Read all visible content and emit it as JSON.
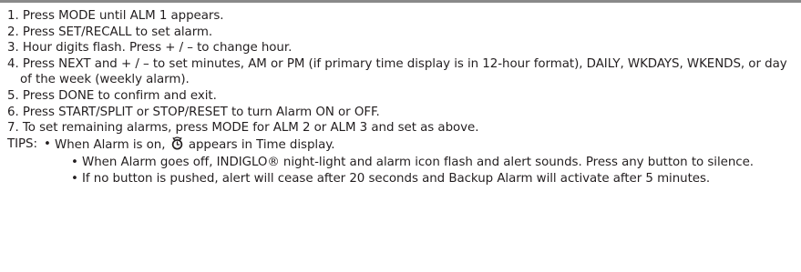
{
  "steps": [
    {
      "number": "1.",
      "text": "Press MODE until ALM 1 appears."
    },
    {
      "number": "2.",
      "text": "Press SET/RECALL to set alarm."
    },
    {
      "number": "3.",
      "text": "Hour digits flash. Press + / – to change hour."
    },
    {
      "number": "4.",
      "text": "Press NEXT and + / – to set minutes, AM or PM (if primary time display is in 12-hour format), DAILY, WKDAYS, WKENDS, or day of the week (weekly alarm)."
    },
    {
      "number": "5.",
      "text": "Press DONE to confirm and exit."
    },
    {
      "number": "6.",
      "text": "Press START/SPLIT or STOP/RESET to turn Alarm ON or OFF."
    },
    {
      "number": "7.",
      "text": "To set remaining alarms, press MODE for ALM 2 or ALM 3 and set as above."
    }
  ],
  "tips": {
    "label": "TIPS:",
    "bullet": "•",
    "items": [
      {
        "before_icon": "When Alarm is on, ",
        "icon": "alarm-clock-icon",
        "after_icon": " appears in Time display."
      },
      {
        "text": "When Alarm goes off, INDIGLO® night-light and alarm icon flash and alert sounds. Press any button to silence."
      },
      {
        "text": "If no button is pushed, alert will cease after 20 seconds and Backup Alarm will activate after 5 minutes."
      }
    ]
  },
  "colors": {
    "text": "#231f20",
    "top_bar": "#8a8a8a"
  }
}
